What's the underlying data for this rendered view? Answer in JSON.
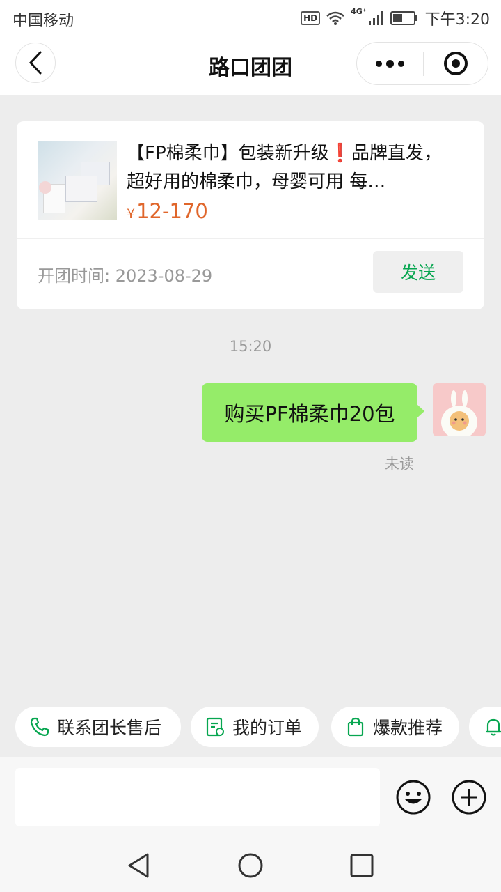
{
  "status_bar": {
    "carrier": "中国移动",
    "hd_badge": "HD",
    "network": "4G⁺",
    "time": "下午3:20",
    "battery_level": 0.45
  },
  "nav": {
    "title": "路口团团",
    "back_icon": "chevron-left-icon",
    "more_icon": "more-dots-icon",
    "close_icon": "target-close-icon"
  },
  "product_card": {
    "title": "【FP棉柔巾】包装新升级❗品牌直发，超好用的棉柔巾，母婴可用 每…",
    "price_currency": "¥",
    "price": "12-170",
    "open_time": "开团时间: 2023-08-29",
    "send_label": "发送"
  },
  "chat": {
    "timestamp": "15:20",
    "messages": [
      {
        "text": "购买PF棉柔巾20包",
        "status": "未读",
        "from": "me"
      }
    ]
  },
  "quick_actions": [
    {
      "label": "联系团长售后",
      "icon": "phone-icon"
    },
    {
      "label": "我的订单",
      "icon": "order-receipt-icon"
    },
    {
      "label": "爆款推荐",
      "icon": "shopping-bag-icon"
    },
    {
      "label": "",
      "icon": "bell-icon"
    }
  ],
  "input_bar": {
    "placeholder": "",
    "emoji_icon": "emoji-smile-icon",
    "plus_icon": "plus-circle-icon"
  },
  "colors": {
    "accent_green": "#07a650",
    "bubble_green": "#95ec69",
    "price_orange": "#e0662b"
  }
}
